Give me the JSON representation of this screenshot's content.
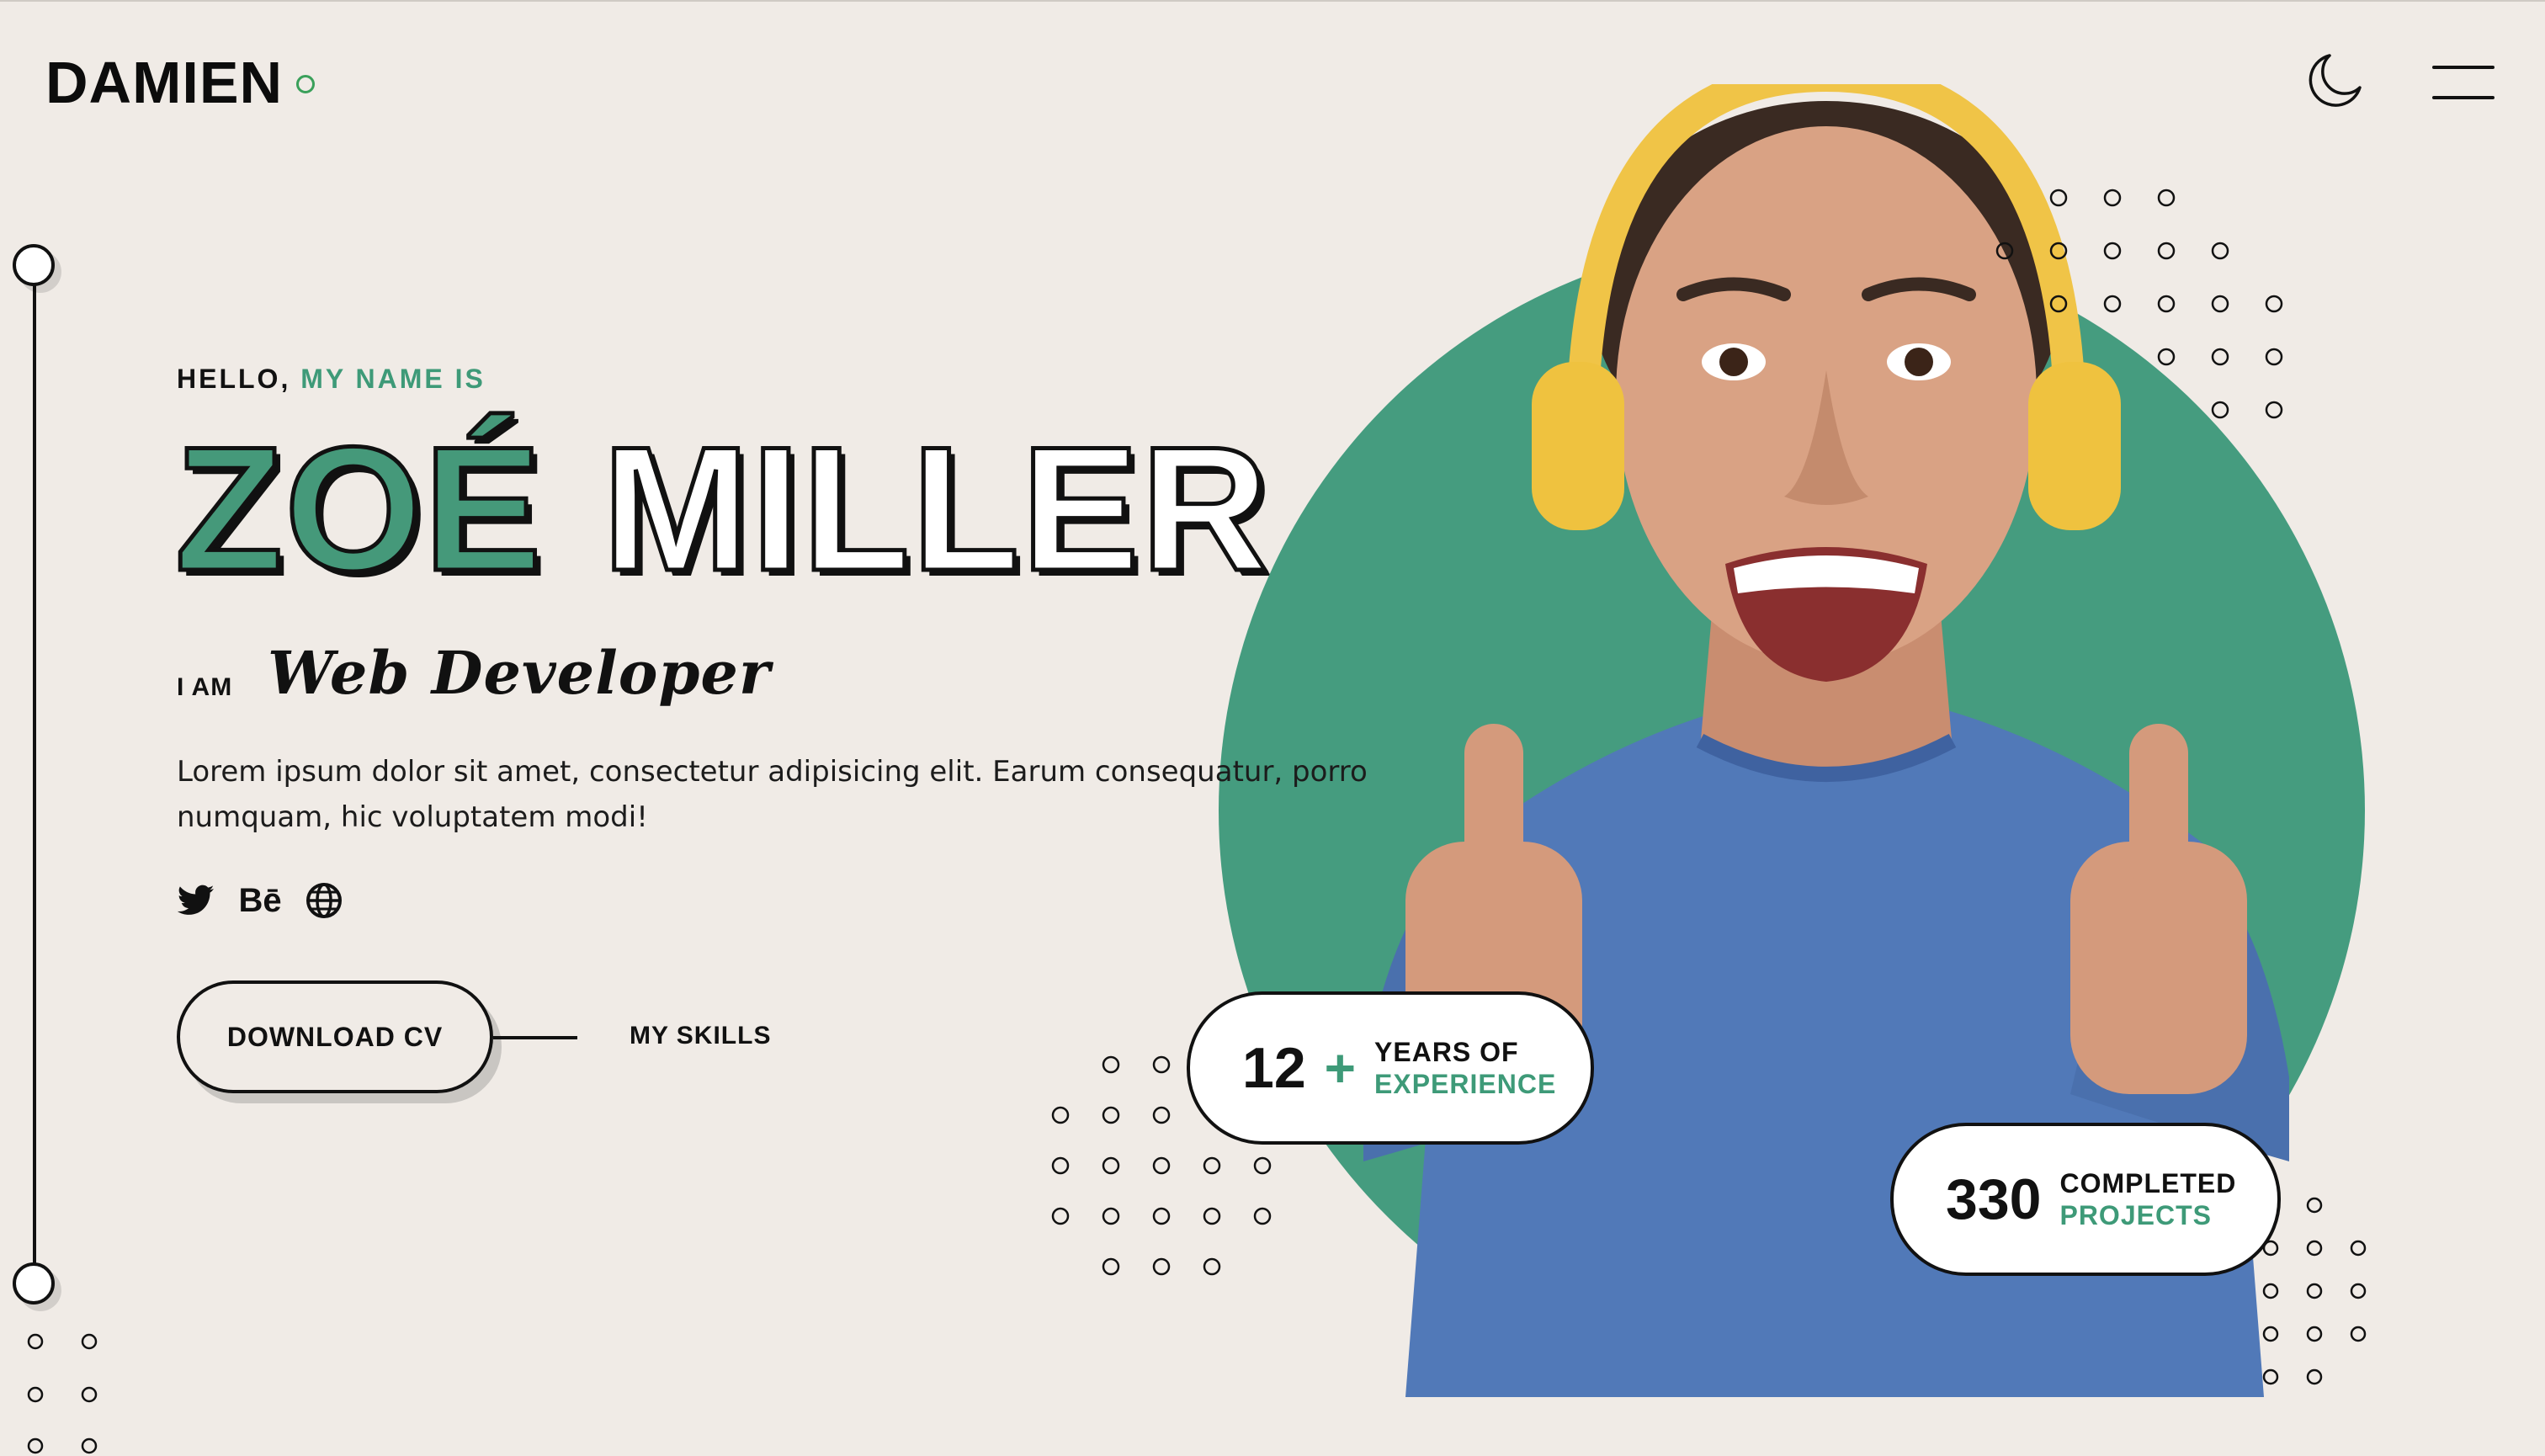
{
  "header": {
    "logo": "DAMIEN"
  },
  "hero": {
    "greeting_part1": "HELLO,",
    "greeting_part2": "MY NAME IS",
    "first_name": "ZOÉ",
    "last_name": "MILLER",
    "iam_label": "I AM",
    "role": "Web Developer",
    "description": "Lorem ipsum dolor sit amet, consectetur adipisicing elit. Earum consequatur, porro numquam, hic voluptatem modi!",
    "social": [
      {
        "icon": "twitter-icon"
      },
      {
        "icon": "behance-icon",
        "label": "Bē"
      },
      {
        "icon": "globe-icon"
      }
    ],
    "download_cv_label": "DOWNLOAD CV",
    "my_skills_label": "MY SKILLS"
  },
  "stats": {
    "experience_number": "12",
    "experience_plus": "+",
    "experience_line1": "YEARS OF",
    "experience_line2": "EXPERIENCE",
    "projects_number": "330",
    "projects_line1": "COMPLETED",
    "projects_line2": "PROJECTS"
  },
  "colors": {
    "background": "#f0ebe6",
    "accent_green": "#459c7f",
    "logo_dot": "#3aa05a",
    "text": "#111111"
  }
}
